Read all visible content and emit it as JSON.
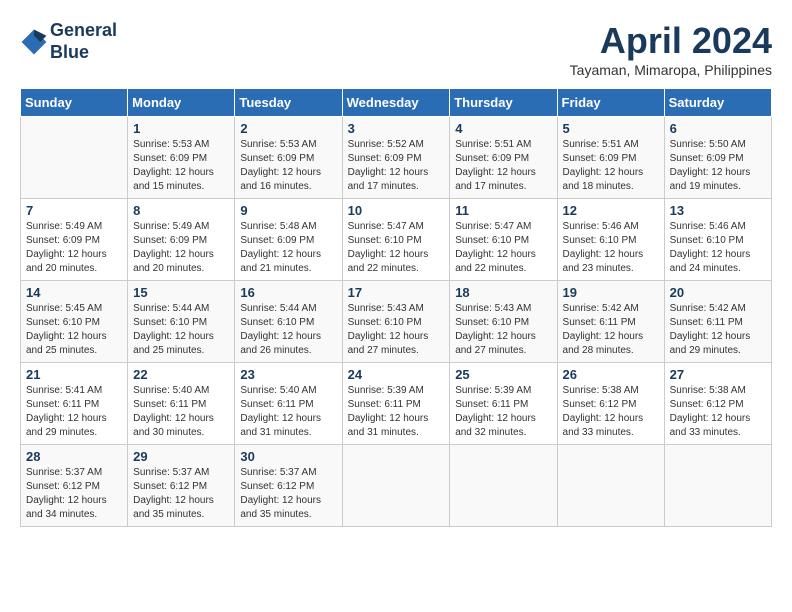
{
  "header": {
    "logo_line1": "General",
    "logo_line2": "Blue",
    "month_title": "April 2024",
    "location": "Tayaman, Mimaropa, Philippines"
  },
  "days_of_week": [
    "Sunday",
    "Monday",
    "Tuesday",
    "Wednesday",
    "Thursday",
    "Friday",
    "Saturday"
  ],
  "weeks": [
    [
      {
        "num": "",
        "sunrise": "",
        "sunset": "",
        "daylight": ""
      },
      {
        "num": "1",
        "sunrise": "Sunrise: 5:53 AM",
        "sunset": "Sunset: 6:09 PM",
        "daylight": "Daylight: 12 hours and 15 minutes."
      },
      {
        "num": "2",
        "sunrise": "Sunrise: 5:53 AM",
        "sunset": "Sunset: 6:09 PM",
        "daylight": "Daylight: 12 hours and 16 minutes."
      },
      {
        "num": "3",
        "sunrise": "Sunrise: 5:52 AM",
        "sunset": "Sunset: 6:09 PM",
        "daylight": "Daylight: 12 hours and 17 minutes."
      },
      {
        "num": "4",
        "sunrise": "Sunrise: 5:51 AM",
        "sunset": "Sunset: 6:09 PM",
        "daylight": "Daylight: 12 hours and 17 minutes."
      },
      {
        "num": "5",
        "sunrise": "Sunrise: 5:51 AM",
        "sunset": "Sunset: 6:09 PM",
        "daylight": "Daylight: 12 hours and 18 minutes."
      },
      {
        "num": "6",
        "sunrise": "Sunrise: 5:50 AM",
        "sunset": "Sunset: 6:09 PM",
        "daylight": "Daylight: 12 hours and 19 minutes."
      }
    ],
    [
      {
        "num": "7",
        "sunrise": "Sunrise: 5:49 AM",
        "sunset": "Sunset: 6:09 PM",
        "daylight": "Daylight: 12 hours and 20 minutes."
      },
      {
        "num": "8",
        "sunrise": "Sunrise: 5:49 AM",
        "sunset": "Sunset: 6:09 PM",
        "daylight": "Daylight: 12 hours and 20 minutes."
      },
      {
        "num": "9",
        "sunrise": "Sunrise: 5:48 AM",
        "sunset": "Sunset: 6:09 PM",
        "daylight": "Daylight: 12 hours and 21 minutes."
      },
      {
        "num": "10",
        "sunrise": "Sunrise: 5:47 AM",
        "sunset": "Sunset: 6:10 PM",
        "daylight": "Daylight: 12 hours and 22 minutes."
      },
      {
        "num": "11",
        "sunrise": "Sunrise: 5:47 AM",
        "sunset": "Sunset: 6:10 PM",
        "daylight": "Daylight: 12 hours and 22 minutes."
      },
      {
        "num": "12",
        "sunrise": "Sunrise: 5:46 AM",
        "sunset": "Sunset: 6:10 PM",
        "daylight": "Daylight: 12 hours and 23 minutes."
      },
      {
        "num": "13",
        "sunrise": "Sunrise: 5:46 AM",
        "sunset": "Sunset: 6:10 PM",
        "daylight": "Daylight: 12 hours and 24 minutes."
      }
    ],
    [
      {
        "num": "14",
        "sunrise": "Sunrise: 5:45 AM",
        "sunset": "Sunset: 6:10 PM",
        "daylight": "Daylight: 12 hours and 25 minutes."
      },
      {
        "num": "15",
        "sunrise": "Sunrise: 5:44 AM",
        "sunset": "Sunset: 6:10 PM",
        "daylight": "Daylight: 12 hours and 25 minutes."
      },
      {
        "num": "16",
        "sunrise": "Sunrise: 5:44 AM",
        "sunset": "Sunset: 6:10 PM",
        "daylight": "Daylight: 12 hours and 26 minutes."
      },
      {
        "num": "17",
        "sunrise": "Sunrise: 5:43 AM",
        "sunset": "Sunset: 6:10 PM",
        "daylight": "Daylight: 12 hours and 27 minutes."
      },
      {
        "num": "18",
        "sunrise": "Sunrise: 5:43 AM",
        "sunset": "Sunset: 6:10 PM",
        "daylight": "Daylight: 12 hours and 27 minutes."
      },
      {
        "num": "19",
        "sunrise": "Sunrise: 5:42 AM",
        "sunset": "Sunset: 6:11 PM",
        "daylight": "Daylight: 12 hours and 28 minutes."
      },
      {
        "num": "20",
        "sunrise": "Sunrise: 5:42 AM",
        "sunset": "Sunset: 6:11 PM",
        "daylight": "Daylight: 12 hours and 29 minutes."
      }
    ],
    [
      {
        "num": "21",
        "sunrise": "Sunrise: 5:41 AM",
        "sunset": "Sunset: 6:11 PM",
        "daylight": "Daylight: 12 hours and 29 minutes."
      },
      {
        "num": "22",
        "sunrise": "Sunrise: 5:40 AM",
        "sunset": "Sunset: 6:11 PM",
        "daylight": "Daylight: 12 hours and 30 minutes."
      },
      {
        "num": "23",
        "sunrise": "Sunrise: 5:40 AM",
        "sunset": "Sunset: 6:11 PM",
        "daylight": "Daylight: 12 hours and 31 minutes."
      },
      {
        "num": "24",
        "sunrise": "Sunrise: 5:39 AM",
        "sunset": "Sunset: 6:11 PM",
        "daylight": "Daylight: 12 hours and 31 minutes."
      },
      {
        "num": "25",
        "sunrise": "Sunrise: 5:39 AM",
        "sunset": "Sunset: 6:11 PM",
        "daylight": "Daylight: 12 hours and 32 minutes."
      },
      {
        "num": "26",
        "sunrise": "Sunrise: 5:38 AM",
        "sunset": "Sunset: 6:12 PM",
        "daylight": "Daylight: 12 hours and 33 minutes."
      },
      {
        "num": "27",
        "sunrise": "Sunrise: 5:38 AM",
        "sunset": "Sunset: 6:12 PM",
        "daylight": "Daylight: 12 hours and 33 minutes."
      }
    ],
    [
      {
        "num": "28",
        "sunrise": "Sunrise: 5:37 AM",
        "sunset": "Sunset: 6:12 PM",
        "daylight": "Daylight: 12 hours and 34 minutes."
      },
      {
        "num": "29",
        "sunrise": "Sunrise: 5:37 AM",
        "sunset": "Sunset: 6:12 PM",
        "daylight": "Daylight: 12 hours and 35 minutes."
      },
      {
        "num": "30",
        "sunrise": "Sunrise: 5:37 AM",
        "sunset": "Sunset: 6:12 PM",
        "daylight": "Daylight: 12 hours and 35 minutes."
      },
      {
        "num": "",
        "sunrise": "",
        "sunset": "",
        "daylight": ""
      },
      {
        "num": "",
        "sunrise": "",
        "sunset": "",
        "daylight": ""
      },
      {
        "num": "",
        "sunrise": "",
        "sunset": "",
        "daylight": ""
      },
      {
        "num": "",
        "sunrise": "",
        "sunset": "",
        "daylight": ""
      }
    ]
  ]
}
